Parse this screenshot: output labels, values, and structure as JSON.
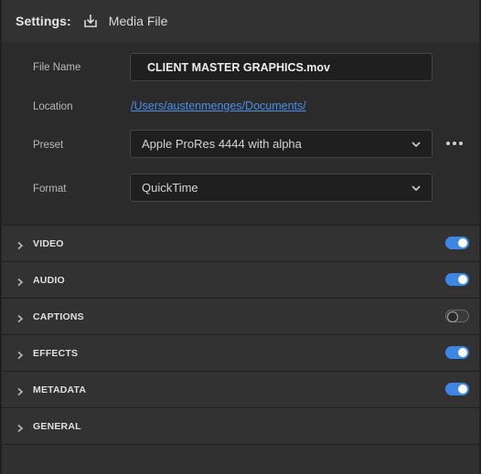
{
  "header": {
    "title": "Settings:",
    "icon": "export-download-icon",
    "label": "Media File"
  },
  "fields": {
    "file_name_label": "File Name",
    "file_name_value": "CLIENT MASTER GRAPHICS.mov",
    "location_label": "Location",
    "location_value": "/Users/austenmenges/Documents/",
    "preset_label": "Preset",
    "preset_value": "Apple ProRes 4444 with alpha",
    "format_label": "Format",
    "format_value": "QuickTime"
  },
  "sections": [
    {
      "title": "VIDEO",
      "toggle": true
    },
    {
      "title": "AUDIO",
      "toggle": true
    },
    {
      "title": "CAPTIONS",
      "toggle": false
    },
    {
      "title": "EFFECTS",
      "toggle": true
    },
    {
      "title": "METADATA",
      "toggle": true
    },
    {
      "title": "GENERAL",
      "toggle": null
    }
  ],
  "colors": {
    "accent": "#3d86e3",
    "link": "#4b8fe6",
    "panel_bg": "#323232",
    "field_bg": "#1f1f1f"
  }
}
